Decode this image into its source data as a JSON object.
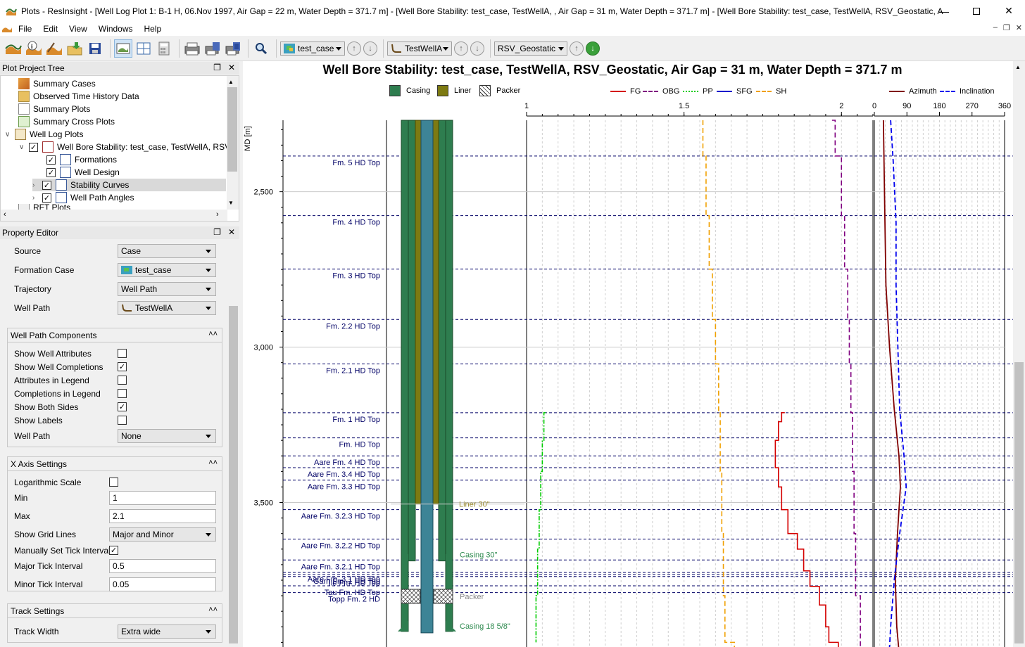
{
  "window": {
    "title": "Plots - ResInsight - [Well Log Plot 1: B-1 H, 06.Nov 1997, Air Gap = 22 m, Water Depth = 371.7 m] - [Well Bore Stability: test_case, TestWellA, , Air Gap = 31 m, Water Depth = 371.7 m] - [Well Bore Stability: test_case, TestWellA, RSV_Geostatic, Air ..."
  },
  "menu": {
    "file": "File",
    "edit": "Edit",
    "view": "View",
    "windows": "Windows",
    "help": "Help"
  },
  "toolbar": {
    "case_combo": "test_case",
    "well_combo": "TestWellA",
    "result_combo": "RSV_Geostatic"
  },
  "tree_panel": {
    "title": "Plot Project Tree",
    "items": [
      "Summary Cases",
      "Observed Time History Data",
      "Summary Plots",
      "Summary Cross Plots",
      "Well Log Plots",
      "Well Bore Stability: test_case, TestWellA, RSV_",
      "Formations",
      "Well Design",
      "Stability Curves",
      "Well Path Angles",
      "RFT Plots"
    ]
  },
  "prop_panel": {
    "title": "Property Editor",
    "source_label": "Source",
    "source_value": "Case",
    "formation_case_label": "Formation Case",
    "formation_case_value": "test_case",
    "trajectory_label": "Trajectory",
    "trajectory_value": "Well Path",
    "wellpath_label": "Well Path",
    "wellpath_value": "TestWellA",
    "wpc_title": "Well Path Components",
    "wpc": [
      {
        "label": "Show Well Attributes",
        "checked": false
      },
      {
        "label": "Show Well Completions",
        "checked": true
      },
      {
        "label": "Attributes in Legend",
        "checked": false
      },
      {
        "label": "Completions in Legend",
        "checked": false
      },
      {
        "label": "Show Both Sides",
        "checked": true
      },
      {
        "label": "Show Labels",
        "checked": false
      }
    ],
    "wpc_wellpath_label": "Well Path",
    "wpc_wellpath_value": "None",
    "xaxis_title": "X Axis Settings",
    "log_label": "Logarithmic Scale",
    "log_checked": false,
    "min_label": "Min",
    "min_value": "1",
    "max_label": "Max",
    "max_value": "2.1",
    "grid_label": "Show Grid Lines",
    "grid_value": "Major and Minor",
    "manual_label": "Manually Set Tick Intervals",
    "manual_checked": true,
    "major_label": "Major Tick Interval",
    "major_value": "0.5",
    "minor_label": "Minor Tick Interval",
    "minor_value": "0.05",
    "track_title": "Track Settings",
    "width_label": "Track Width",
    "width_value": "Extra wide"
  },
  "plot": {
    "title": "Well Bore Stability: test_case, TestWellA, RSV_Geostatic, Air Gap = 31 m, Water Depth = 371.7 m",
    "depth_axis_label": "MD [m]",
    "design_legend": [
      "Casing",
      "Liner",
      "Packer"
    ],
    "stability_legend": [
      "FG",
      "OBG",
      "PP",
      "SFG",
      "SH"
    ],
    "angles_legend": [
      "Azimuth",
      "Inclination"
    ],
    "colors": {
      "casing": "#2e7d4f",
      "liner": "#7d7a12",
      "tubing": "#3d8496",
      "FG": "#d40000",
      "OBG": "#800080",
      "PP": "#00cc00",
      "SFG": "#0000cc",
      "SH": "#f0a000",
      "azimuth": "#800000",
      "inclination": "#0000ee",
      "formation": "#000066"
    },
    "annotations": {
      "liner": "Liner 30\"",
      "casing30": "Casing 30\"",
      "packer": "Packer",
      "casing18": "Casing 18 5/8\""
    }
  },
  "chart_data": {
    "type": "line",
    "depth_range": [
      2270,
      3965
    ],
    "depth_ticks": [
      2500,
      3000,
      3500
    ],
    "depth_tick_labels": [
      "2,500",
      "3,000",
      "3,500"
    ],
    "formations": [
      {
        "name": "Fm. 5 HD Top",
        "md": 2385
      },
      {
        "name": "Fm. 4 HD Top",
        "md": 2577
      },
      {
        "name": "Fm. 3 HD Top",
        "md": 2749
      },
      {
        "name": "Fm. 2.2 HD Top",
        "md": 2911
      },
      {
        "name": "Fm. 2.1 HD Top",
        "md": 3054
      },
      {
        "name": "Fm. 1 HD Top",
        "md": 3211
      },
      {
        "name": "Fm. HD Top",
        "md": 3292
      },
      {
        "name": "Aare Fm. 4 HD Top",
        "md": 3350
      },
      {
        "name": "Aare Fm. 3.4 HD Top",
        "md": 3388
      },
      {
        "name": "Aare Fm. 3.3 HD Top",
        "md": 3428
      },
      {
        "name": "Aare Fm. 3.2.3 HD Top",
        "md": 3523
      },
      {
        "name": "Aare Fm. 3.2.2 HD Top",
        "md": 3618
      },
      {
        "name": "Aare Fm. 3.2.1 HD Top",
        "md": 3685
      },
      {
        "name": "Aare Fm. 3.1 HD Top",
        "md": 3725
      },
      {
        "name": "Garn Fm. 1 HD Top",
        "md": 3732
      },
      {
        "name": "Ile Fm. HD Top",
        "md": 3738
      },
      {
        "name": "Tau Fm. HD Top",
        "md": 3768
      },
      {
        "name": "Topp Fm. 2 HD",
        "md": 3790
      }
    ],
    "stability_track": {
      "xlim": [
        1,
        2.1
      ],
      "ticks": [
        1,
        1.5,
        2
      ],
      "tick_labels": [
        "1",
        "1.5",
        "2"
      ],
      "series": [
        {
          "name": "OBG",
          "points": [
            [
              1.97,
              2270
            ],
            [
              1.98,
              2385
            ],
            [
              1.99,
              2385
            ],
            [
              2.0,
              2577
            ],
            [
              2.01,
              2749
            ],
            [
              2.02,
              2911
            ],
            [
              2.025,
              3054
            ],
            [
              2.03,
              3211
            ],
            [
              2.035,
              3400
            ],
            [
              2.04,
              3600
            ],
            [
              2.045,
              3800
            ],
            [
              2.06,
              3965
            ]
          ]
        },
        {
          "name": "SH",
          "points": [
            [
              1.56,
              2270
            ],
            [
              1.56,
              2385
            ],
            [
              1.57,
              2577
            ],
            [
              1.58,
              2749
            ],
            [
              1.59,
              2911
            ],
            [
              1.6,
              3054
            ],
            [
              1.61,
              3211
            ],
            [
              1.615,
              3400
            ],
            [
              1.62,
              3600
            ],
            [
              1.625,
              3800
            ],
            [
              1.63,
              3950
            ],
            [
              1.66,
              3965
            ]
          ]
        },
        {
          "name": "FG",
          "points": [
            [
              1.82,
              3211
            ],
            [
              1.81,
              3240
            ],
            [
              1.8,
              3300
            ],
            [
              1.79,
              3388
            ],
            [
              1.8,
              3450
            ],
            [
              1.81,
              3523
            ],
            [
              1.83,
              3600
            ],
            [
              1.86,
              3650
            ],
            [
              1.88,
              3720
            ],
            [
              1.9,
              3770
            ],
            [
              1.93,
              3830
            ],
            [
              1.95,
              3900
            ],
            [
              1.96,
              3950
            ],
            [
              1.99,
              3965
            ]
          ]
        },
        {
          "name": "PP",
          "points": [
            [
              1.06,
              3211
            ],
            [
              1.055,
              3300
            ],
            [
              1.05,
              3400
            ],
            [
              1.045,
              3523
            ],
            [
              1.04,
              3650
            ],
            [
              1.035,
              3800
            ],
            [
              1.03,
              3950
            ]
          ]
        }
      ]
    },
    "angles_track": {
      "xlim": [
        0,
        360
      ],
      "ticks": [
        0,
        90,
        180,
        270,
        360
      ],
      "tick_labels": [
        "0",
        "90",
        "180",
        "270",
        "360"
      ],
      "series": [
        {
          "name": "Azimuth",
          "points": [
            [
              25,
              2270
            ],
            [
              28,
              2500
            ],
            [
              32,
              2800
            ],
            [
              42,
              3000
            ],
            [
              55,
              3200
            ],
            [
              68,
              3350
            ],
            [
              72,
              3450
            ],
            [
              64,
              3600
            ],
            [
              58,
              3750
            ],
            [
              62,
              3900
            ],
            [
              67,
              3965
            ]
          ]
        },
        {
          "name": "Inclination",
          "points": [
            [
              45,
              2270
            ],
            [
              52,
              2400
            ],
            [
              60,
              2600
            ],
            [
              60,
              2800
            ],
            [
              65,
              3000
            ],
            [
              70,
              3200
            ],
            [
              82,
              3350
            ],
            [
              88,
              3450
            ],
            [
              70,
              3600
            ],
            [
              55,
              3750
            ],
            [
              45,
              3900
            ],
            [
              42,
              3965
            ]
          ]
        }
      ]
    },
    "well_design": {
      "liner_bottom_md": 3505,
      "casing30_md": 3688,
      "packer_md": 3802,
      "casing18_md": 3915
    }
  }
}
